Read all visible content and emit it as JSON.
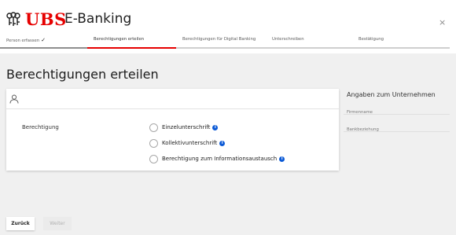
{
  "header": {
    "brand": "UBS",
    "app_title": "E-Banking",
    "close_label": "×",
    "accent_color": "#e60000"
  },
  "steps": [
    {
      "label": "Person erfassen",
      "state": "done"
    },
    {
      "label": "Berechtigungen erteilen",
      "state": "active"
    },
    {
      "label": "Berechtigungen für Digital Banking",
      "state": "pending"
    },
    {
      "label": "Unterschreiben",
      "state": "pending"
    },
    {
      "label": "Bestätigung",
      "state": "pending"
    }
  ],
  "step_done_mark": "✓",
  "main": {
    "heading": "Berechtigungen erteilen",
    "card": {
      "icon": "user-icon",
      "field_label": "Berechtigung",
      "options": [
        {
          "label": "Einzelunterschrift",
          "info_icon": "i"
        },
        {
          "label": "Kollektivunterschrift",
          "info_icon": "i"
        },
        {
          "label": "Berechtigung zum Informationsaustausch",
          "info_icon": "i"
        }
      ]
    }
  },
  "sidebar": {
    "title": "Angaben zum Unternehmen",
    "fields": [
      "Firmenname",
      "Bankbeziehung"
    ]
  },
  "footer": {
    "back_label": "Zurück",
    "next_label": "Weiter"
  }
}
